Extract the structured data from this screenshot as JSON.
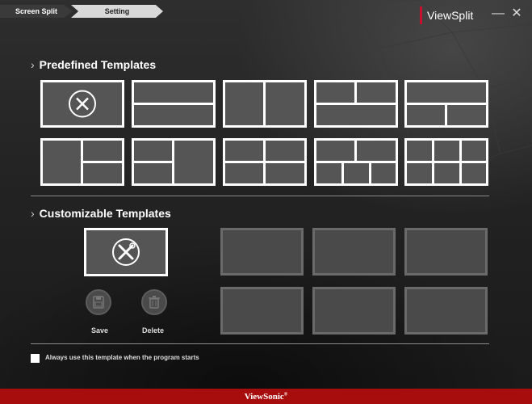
{
  "header": {
    "steps": [
      "Screen Split",
      "Setting"
    ],
    "app_title": "ViewSplit",
    "minimize_glyph": "—",
    "close_glyph": "✕"
  },
  "predefined": {
    "title": "Predefined Templates",
    "templates": [
      {
        "name": "no-split",
        "icon": "x-circle-icon"
      },
      {
        "name": "two-horizontal"
      },
      {
        "name": "two-vertical"
      },
      {
        "name": "top-two-bottom-one"
      },
      {
        "name": "top-one-bottom-two"
      },
      {
        "name": "left-one-right-two"
      },
      {
        "name": "left-two-right-one"
      },
      {
        "name": "four-grid"
      },
      {
        "name": "top-two-bottom-three"
      },
      {
        "name": "six-grid"
      }
    ]
  },
  "customizable": {
    "title": "Customizable Templates",
    "editor_icon": "tools-icon",
    "save_label": "Save",
    "delete_label": "Delete",
    "slot_count": 6
  },
  "startup": {
    "checkbox_label": "Always use this template when the program starts",
    "checked": false
  },
  "footer": {
    "brand": "ViewSonic",
    "brand_mark": "®"
  },
  "colors": {
    "accent_red": "#c8102e",
    "footer_red": "#a80d0d",
    "tile_gray": "#555555"
  }
}
